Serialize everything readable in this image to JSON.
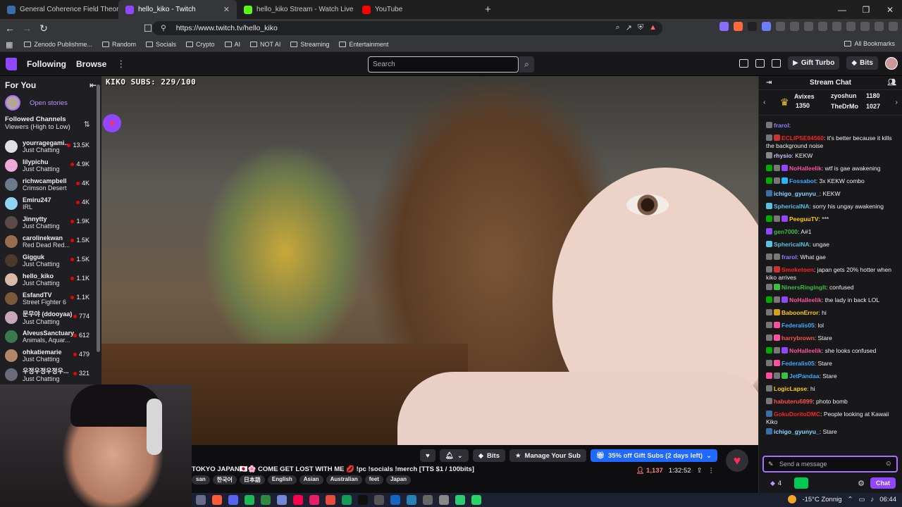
{
  "browser": {
    "tabs": [
      {
        "title": "General Coherence Field Theory (GC",
        "color": "#3a6ea5"
      },
      {
        "title": "hello_kiko - Twitch",
        "color": "#9147ff"
      },
      {
        "title": "hello_kiko Stream - Watch Live or",
        "color": "#53fc18"
      },
      {
        "title": "YouTube",
        "color": "#ff0000"
      }
    ],
    "url": "https://www.twitch.tv/hello_kiko",
    "bookmarks": [
      "Zenodo Publishme...",
      "Random",
      "Socials",
      "Crypto",
      "AI",
      "NOT AI",
      "Streaming",
      "Entertainment"
    ],
    "all_bookmarks": "All Bookmarks"
  },
  "twitch_nav": {
    "following": "Following",
    "browse": "Browse",
    "search_placeholder": "Search",
    "gift_turbo": "Gift Turbo",
    "bits": "Bits"
  },
  "sidebar": {
    "for_you": "For You",
    "open_stories": "Open stories",
    "followed_title": "Followed Channels",
    "followed_sort": "Viewers (High to Low)",
    "channels": [
      {
        "name": "yourragegami...",
        "game": "Just Chatting",
        "viewers": "13.5K",
        "color": "#e0e0e0"
      },
      {
        "name": "lilypichu",
        "game": "Just Chatting",
        "viewers": "4.9K",
        "color": "#f2a8d6"
      },
      {
        "name": "richwcampbell",
        "game": "Crimson Desert",
        "viewers": "4K",
        "color": "#6b7a8a"
      },
      {
        "name": "Emiru247",
        "game": "IRL",
        "viewers": "4K",
        "color": "#8fd3f5"
      },
      {
        "name": "Jinnytty",
        "game": "Just Chatting",
        "viewers": "1.9K",
        "color": "#5a4a4a"
      },
      {
        "name": "carolinekwan",
        "game": "Red Dead Red...",
        "viewers": "1.5K",
        "color": "#9b6b4e"
      },
      {
        "name": "Gigguk",
        "game": "Just Chatting",
        "viewers": "1.5K",
        "color": "#4a3a2a"
      },
      {
        "name": "hello_kiko",
        "game": "Just Chatting",
        "viewers": "1.1K",
        "color": "#d9b9a9"
      },
      {
        "name": "EsfandTV",
        "game": "Street Fighter 6",
        "viewers": "1.1K",
        "color": "#7a5a3a"
      },
      {
        "name": "문무야 (ddooyaa)",
        "game": "Just Chatting",
        "viewers": "774",
        "color": "#c8a8b8"
      },
      {
        "name": "AlveusSanctuary",
        "game": "Animals, Aquar...",
        "viewers": "612",
        "color": "#3a7a4a"
      },
      {
        "name": "ohkatiemarie",
        "game": "Just Chatting",
        "viewers": "479",
        "color": "#b08868"
      },
      {
        "name": "우정우정우정우...",
        "game": "Just Chatting",
        "viewers": "321",
        "color": "#6a6a7a"
      }
    ]
  },
  "video": {
    "subs_overlay": "KIKO SUBS: 229/100"
  },
  "stream_info": {
    "title": "TOKYO JAPAN🇯🇵🌸 COME GET LOST WITH ME 💋 !pc !socials !merch [TTS $1 / 100bits]",
    "tags": [
      "san",
      "한국어",
      "日本語",
      "English",
      "Asian",
      "Australian",
      "feet",
      "Japan"
    ],
    "viewers": "1,137",
    "uptime": "1:32:52",
    "bits_label": "Bits",
    "manage_sub": "Manage Your Sub",
    "gift_subs": "35% off Gift Subs (2 days left)"
  },
  "chat": {
    "header": "Stream Chat",
    "leaderboard": [
      {
        "name": "Avixes",
        "value": "1350"
      },
      {
        "name": "zyoshun",
        "value": "1180"
      },
      {
        "name": "TheDrMo",
        "value": "1027"
      }
    ],
    "messages": [
      {
        "user": "frarol",
        "color": "#8a7dff",
        "text": "",
        "badges": [
          "#777"
        ]
      },
      {
        "user": "ECLIPSE94560",
        "color": "#ff2020",
        "text": "it's better because it kills the background noise",
        "badges": [
          "#777",
          "#c33"
        ]
      },
      {
        "user": "rhysio",
        "color": "#c8c8ff",
        "text": "KEKW",
        "badges": [
          "#888"
        ]
      },
      {
        "user": "NoHalleelik",
        "color": "#ff4fa0",
        "text": "wtf is gae awakening",
        "badges": [
          "#0a0",
          "#777",
          "#9147ff"
        ]
      },
      {
        "user": "Fossabot",
        "color": "#3fa9ff",
        "text": "3x KEKW combo",
        "badges": [
          "#0a0",
          "#777",
          "#29b6f6"
        ]
      },
      {
        "user": "ichigo_gyunyu_",
        "color": "#8fd3ff",
        "text": "KEKW",
        "badges": [
          "#3a6ea5"
        ]
      },
      {
        "user": "SphericalNA",
        "color": "#5bc0de",
        "text": "sorry his ungay awakening",
        "badges": [
          "#5bc0de"
        ]
      },
      {
        "user": "PeeguuTV",
        "color": "#ffcc00",
        "text": "***",
        "badges": [
          "#0a0",
          "#777",
          "#9147ff"
        ]
      },
      {
        "user": "gen7000",
        "color": "#3fbf3f",
        "text": "A#1",
        "badges": [
          "#9147ff"
        ]
      },
      {
        "user": "SphericalNA",
        "color": "#5bc0de",
        "text": "ungae",
        "badges": [
          "#5bc0de"
        ]
      },
      {
        "user": "frarol",
        "color": "#8a7dff",
        "text": "What gae",
        "badges": [
          "#777",
          "#777"
        ]
      },
      {
        "user": "Smoketoen",
        "color": "#ff2020",
        "text": "japan gets 20% hotter when kiko arrives",
        "badges": [
          "#777",
          "#c33"
        ]
      },
      {
        "user": "NinersRingingIt",
        "color": "#3fbf3f",
        "text": "confused",
        "badges": [
          "#777",
          "#3fbf3f"
        ]
      },
      {
        "user": "NoHalleelik",
        "color": "#ff4fa0",
        "text": "the lady in back LOL",
        "badges": [
          "#0a0",
          "#777",
          "#9147ff"
        ]
      },
      {
        "user": "BaboonError",
        "color": "#ffcc00",
        "text": "hi",
        "badges": [
          "#777",
          "#d4a017"
        ]
      },
      {
        "user": "Federalis05",
        "color": "#3fa9ff",
        "text": "lol",
        "badges": [
          "#777",
          "#ff4fa0"
        ]
      },
      {
        "user": "harrybrown",
        "color": "#ff4f4f",
        "text": "Stare",
        "badges": [
          "#777",
          "#ff4fa0"
        ]
      },
      {
        "user": "NoHalleelik",
        "color": "#ff4fa0",
        "text": "she looks confused",
        "badges": [
          "#0a0",
          "#777",
          "#9147ff"
        ]
      },
      {
        "user": "Federalis05",
        "color": "#3fa9ff",
        "text": "Stare",
        "badges": [
          "#777",
          "#ff4fa0"
        ]
      },
      {
        "user": "JetPandaa",
        "color": "#3fa9ff",
        "text": "Stare",
        "badges": [
          "#ff4fa0",
          "#777",
          "#3fbf3f"
        ]
      },
      {
        "user": "LogicLapse",
        "color": "#ffcc00",
        "text": "hi",
        "badges": [
          "#777"
        ]
      },
      {
        "user": "habuteru6899",
        "color": "#ff4f4f",
        "text": "photo bomb",
        "badges": [
          "#777"
        ]
      },
      {
        "user": "GokuDoritoDMC",
        "color": "#ff2020",
        "text": "People looking at Kawaii Kiko",
        "badges": [
          "#3a6ea5"
        ]
      },
      {
        "user": "ichigo_gyunyu_",
        "color": "#8fd3ff",
        "text": "Stare",
        "badges": [
          "#3a6ea5"
        ]
      }
    ],
    "input_placeholder": "Send a message",
    "points": "4",
    "chat_button": "Chat"
  },
  "taskbar": {
    "weather": "-15°C  Zonnig",
    "time": "06:44",
    "icon_colors": [
      "#6a6a8a",
      "#ff5a36",
      "#5865f2",
      "#1db954",
      "#2b8a3e",
      "#7289da",
      "#ff0050",
      "#e91e63",
      "#e74c3c",
      "#0f9d58",
      "#111",
      "#555",
      "#1565c0",
      "#2980b9",
      "#666",
      "#888",
      "#2ecc71",
      "#25d366"
    ]
  }
}
